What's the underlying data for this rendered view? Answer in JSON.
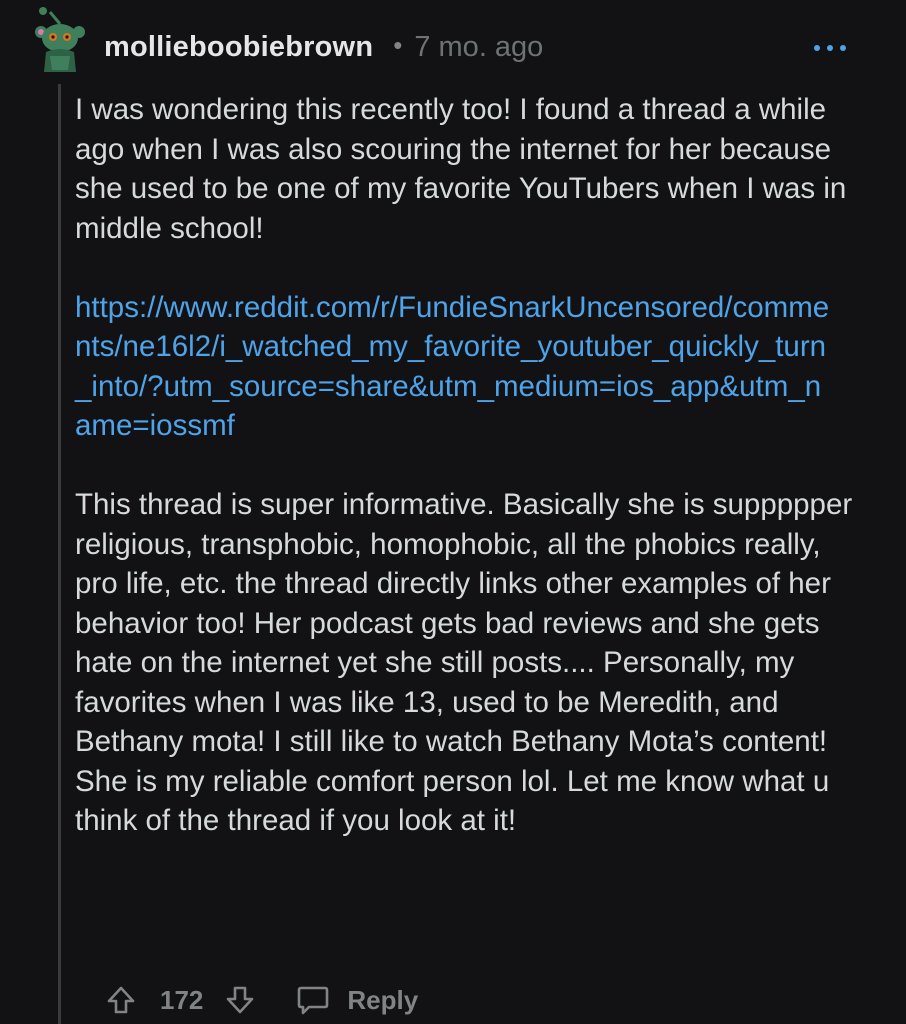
{
  "comment": {
    "username": "mollieboobiebrown",
    "separator": "•",
    "timestamp": "7 mo. ago",
    "paragraphs": [
      "I was wondering this recently too! I found a thread a while ago when I was also scouring the internet for her because she used to be one of my favorite YouTubers when I was in middle school!",
      "This thread is super informative. Basically she is suppppper religious, transphobic, homophobic, all the phobics really, pro life, etc. the thread directly links other examples of her behavior too! Her podcast gets bad reviews and she gets hate on the internet yet she still posts.... Personally, my favorites when I was like 13, used to be Meredith, and Bethany mota! I still like to watch Bethany Mota’s content! She is my reliable comfort person lol. Let me know what u think of the thread if you look at it!"
    ],
    "link": "https://www.reddit.com/r/FundieSnarkUncensored/comments/ne16l2/i_watched_my_favorite_youtuber_quickly_turn_into/?utm_source=share&utm_medium=ios_app&utm_name=iossmf"
  },
  "actions": {
    "vote_count": "172",
    "reply_label": "Reply"
  },
  "colors": {
    "background": "#121214",
    "text": "#d7dadc",
    "link": "#4fa3e8",
    "muted": "#818384",
    "avatar_green": "#3f7f5b"
  },
  "icons": {
    "more": "ellipsis-icon",
    "upvote": "upvote-arrow-icon",
    "downvote": "downvote-arrow-icon",
    "reply": "speech-bubble-icon",
    "avatar": "snoo-avatar-icon"
  }
}
